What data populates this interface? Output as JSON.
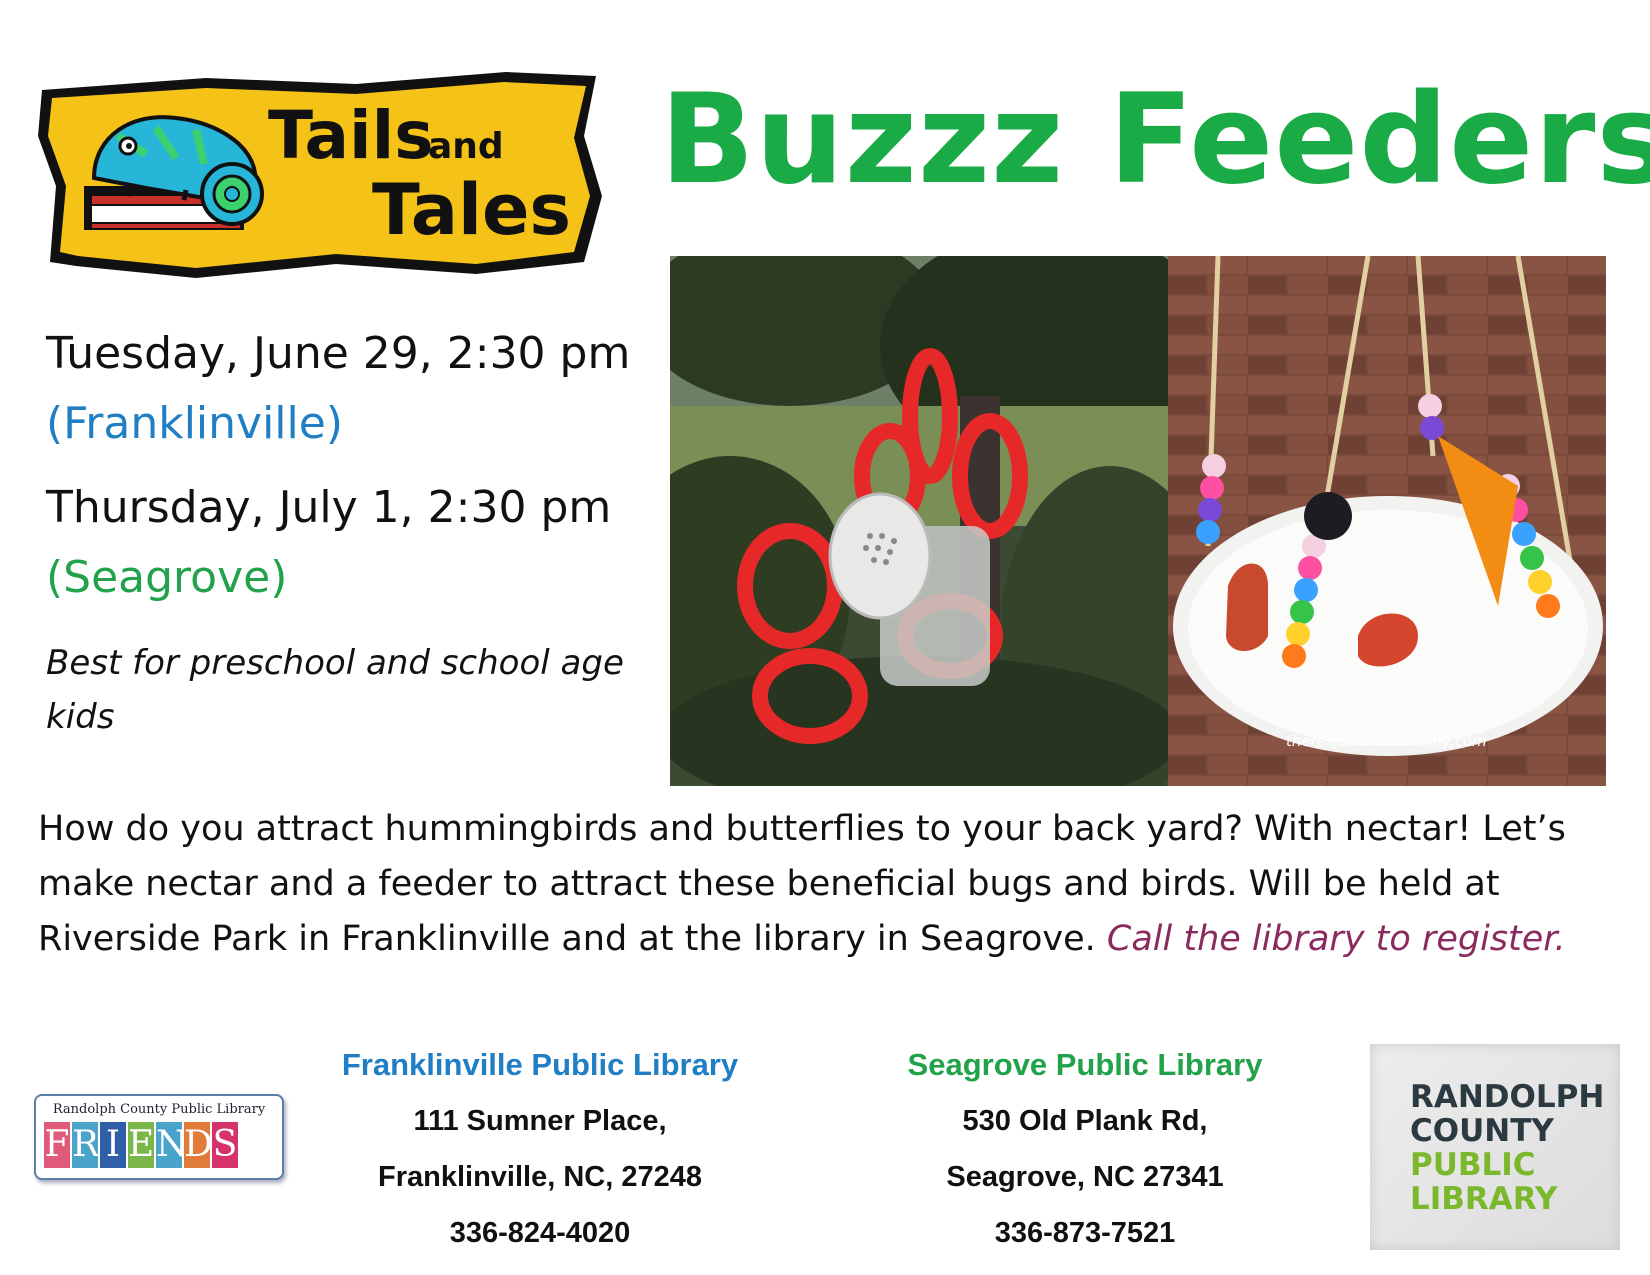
{
  "logo": {
    "line1_big": "Tails",
    "line1_small": "and",
    "line2": "Tales"
  },
  "title": "Buzzz Feeders",
  "schedule": [
    {
      "date": "Tuesday, June 29, 2:30 pm",
      "location": "(Franklinville)"
    },
    {
      "date": "Thursday, July 1, 2:30 pm",
      "location": "(Seagrove)"
    }
  ],
  "age_note": "Best for preschool and school age kids",
  "photo_credit": "theresjustonemommy.com",
  "description": {
    "body": "How do you attract hummingbirds and butterflies to your back yard? With nectar! Let’s make nectar and a feeder to attract these beneficial bugs and birds. Will be held at Riverside Park in Franklinville and at the library in Seagrove. ",
    "call_to_action": "Call the library to register."
  },
  "libraries": [
    {
      "name": "Franklinville Public Library",
      "address1": "111 Sumner Place,",
      "address2": "Franklinville, NC, 27248",
      "phone": "336-824-4020"
    },
    {
      "name": "Seagrove Public Library",
      "address1": "530 Old Plank Rd,",
      "address2": "Seagrove, NC 27341",
      "phone": "336-873-7521"
    }
  ],
  "friends_logo": {
    "top_text": "Randolph County Public Library",
    "letters": [
      "F",
      "R",
      "I",
      "E",
      "N",
      "D",
      "S"
    ],
    "letter_colors": [
      "#e05a7a",
      "#4aa3c8",
      "#2f5fa8",
      "#7ab648",
      "#4aa3c8",
      "#e07b39",
      "#d6336c"
    ]
  },
  "rcpl_logo": {
    "line1": "RANDOLPH",
    "line2": "COUNTY",
    "line3": "PUBLIC",
    "line4": "LIBRARY"
  },
  "colors": {
    "title_green": "#1bab46",
    "franklinville_blue": "#1f7ec4",
    "seagrove_green": "#22a24a",
    "cta_maroon": "#8a2a5e",
    "logo_yellow": "#f5c318"
  }
}
